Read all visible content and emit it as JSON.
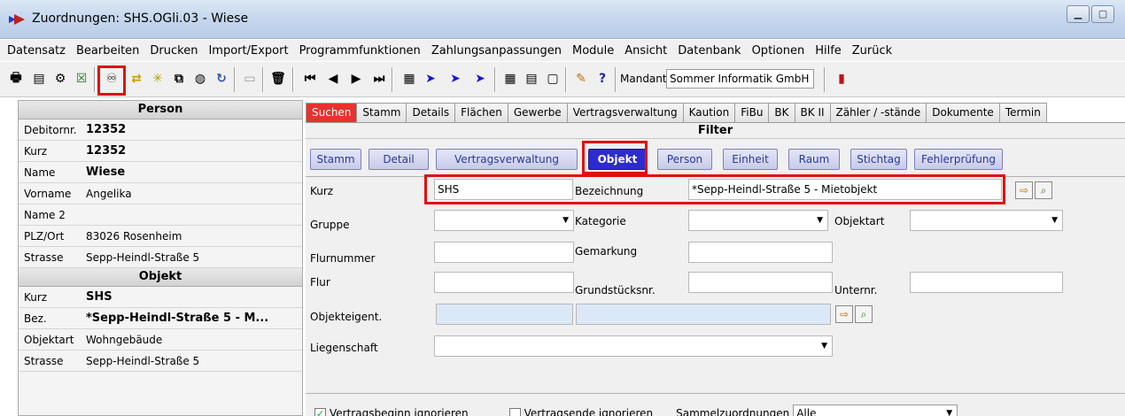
{
  "window": {
    "title": "Zuordnungen: SHS.OGli.03 - Wiese"
  },
  "menu": [
    "Datensatz",
    "Bearbeiten",
    "Drucken",
    "Import/Export",
    "Programmfunktionen",
    "Zahlungsanpassungen",
    "Module",
    "Ansicht",
    "Datenbank",
    "Optionen",
    "Hilfe",
    "Zurück"
  ],
  "toolbar": {
    "mandant_label": "Mandant",
    "mandant_value": "Sommer Informatik GmbH"
  },
  "person": {
    "header": "Person",
    "rows": [
      {
        "label": "Debitornr.",
        "value": "12352"
      },
      {
        "label": "Kurz",
        "value": "12352"
      },
      {
        "label": "Name",
        "value": "Wiese"
      },
      {
        "label": "Vorname",
        "value": "Angelika"
      },
      {
        "label": "Name 2",
        "value": ""
      },
      {
        "label": "PLZ/Ort",
        "value": "83026 Rosenheim"
      },
      {
        "label": "Strasse",
        "value": "Sepp-Heindl-Straße 5"
      }
    ]
  },
  "objekt": {
    "header": "Objekt",
    "rows": [
      {
        "label": "Kurz",
        "value": "SHS"
      },
      {
        "label": "Bez.",
        "value": "*Sepp-Heindl-Straße 5 - M..."
      },
      {
        "label": "Objektart",
        "value": "Wohngebäude"
      },
      {
        "label": "Strasse",
        "value": "Sepp-Heindl-Straße 5"
      }
    ]
  },
  "top_tabs": [
    "Suchen",
    "Stamm",
    "Details",
    "Flächen",
    "Gewerbe",
    "Vertragsverwaltung",
    "Kaution",
    "FiBu",
    "BK",
    "BK II",
    "Zähler / -stände",
    "Dokumente",
    "Termin"
  ],
  "filter": {
    "header": "Filter",
    "tabs": [
      "Stamm",
      "Detail",
      "Vertragsverwaltung",
      "Objekt",
      "Person",
      "Einheit",
      "Raum",
      "Stichtag",
      "Fehlerprüfung"
    ],
    "labels": {
      "kurz": "Kurz",
      "bezeichnung": "Bezeichnung",
      "gruppe": "Gruppe",
      "kategorie": "Kategorie",
      "objektart": "Objektart",
      "flurnummer": "Flurnummer",
      "gemarkung": "Gemarkung",
      "flur": "Flur",
      "grundstuecksnr": "Grundstücksnr.",
      "unternr": "Unternr.",
      "objekteigent": "Objekteigent.",
      "liegenschaft": "Liegenschaft"
    },
    "values": {
      "kurz": "SHS",
      "bezeichnung": "*Sepp-Heindl-Straße 5 - Mietobjekt"
    },
    "bottom": {
      "vertragsbeginn": "Vertragsbeginn ignorieren",
      "vertragsende": "Vertragsende ignorieren",
      "sammel_label": "Sammelzuordnungen",
      "sammel_value": "Alle"
    }
  },
  "colors": {
    "active_tab": "#e8322f",
    "filter_tab": "#2d2bd0",
    "highlight": "#e01010"
  }
}
